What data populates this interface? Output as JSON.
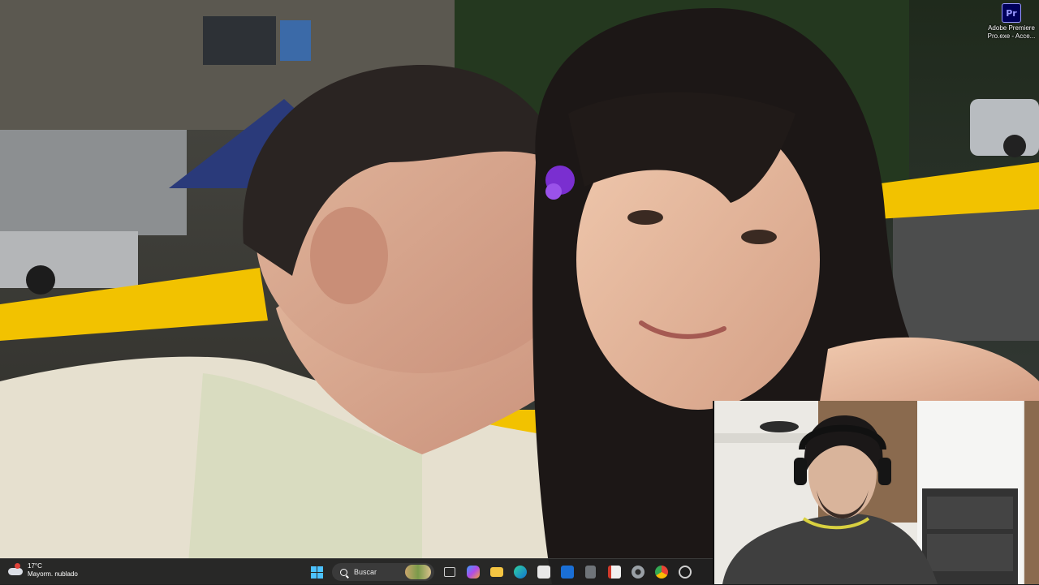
{
  "desktop": {
    "shortcut": {
      "icon_text": "Pr",
      "label": "Adobe Premiere Pro.exe - Acce..."
    }
  },
  "taskbar": {
    "weather": {
      "temperature": "17°C",
      "condition": "Mayorm. nublado"
    },
    "search": {
      "placeholder": "Buscar"
    },
    "pinned_apps": [
      "windows-start",
      "search",
      "task-view",
      "copilot",
      "file-explorer",
      "edge",
      "microsoft-store",
      "outlook",
      "calculator",
      "editor",
      "settings",
      "chrome",
      "obs-studio"
    ]
  },
  "colors": {
    "taskbar_bg": "#202020",
    "rail_yellow": "#f2c200",
    "accent": "#4cc2ff"
  }
}
